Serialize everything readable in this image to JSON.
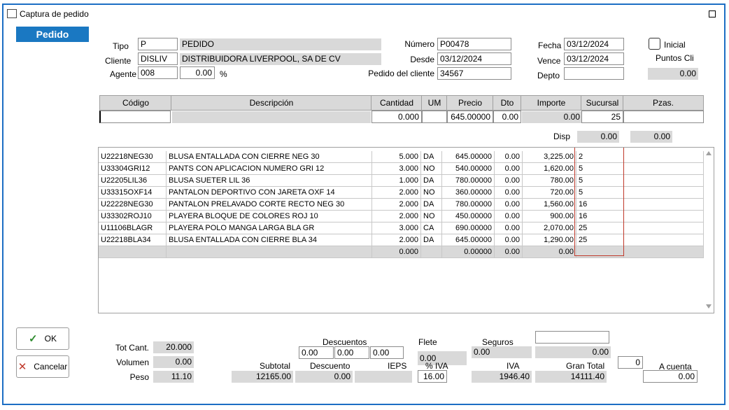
{
  "window": {
    "title": "Captura de pedido",
    "tab_label": "Pedido"
  },
  "header": {
    "tipo_label": "Tipo",
    "tipo_code": "P",
    "tipo_name": "PEDIDO",
    "cliente_label": "Cliente",
    "cliente_code": "DISLIV",
    "cliente_name": "DISTRIBUIDORA LIVERPOOL, SA DE CV",
    "agente_label": "Agente",
    "agente_code": "008",
    "agente_pct": "0.00",
    "pct_symbol": "%",
    "numero_label": "Número",
    "numero_value": "P00478",
    "desde_label": "Desde",
    "desde_value": "03/12/2024",
    "pedido_cliente_label": "Pedido del cliente",
    "pedido_cliente_value": "34567",
    "fecha_label": "Fecha",
    "fecha_value": "03/12/2024",
    "vence_label": "Vence",
    "vence_value": "03/12/2024",
    "depto_label": "Depto",
    "depto_value": "",
    "inicial_label": "Inicial",
    "puntos_label": "Puntos Cli",
    "puntos_value": "0.00"
  },
  "entry": {
    "headers": [
      "Código",
      "Descripción",
      "Cantidad",
      "UM",
      "Precio",
      "Dto",
      "Importe",
      "Sucursal",
      "Pzas."
    ],
    "codigo": "",
    "descripcion": "",
    "cantidad": "0.000",
    "um": "",
    "precio": "645.00000",
    "dto": "0.00",
    "importe": "0.00",
    "sucursal": "25",
    "pzas": "",
    "disp_label": "Disp",
    "disp_value": "0.00",
    "disp_value2": "0.00"
  },
  "lines": [
    {
      "codigo": "U22218NEG30",
      "descripcion": "BLUSA ENTALLADA CON CIERRE NEG 30",
      "cantidad": "5.000",
      "um": "DA",
      "precio": "645.00000",
      "dto": "0.00",
      "importe": "3,225.00",
      "sucursal": "2"
    },
    {
      "codigo": "U33304GRI12",
      "descripcion": "PANTS CON APLICACION NUMERO GRI 12",
      "cantidad": "3.000",
      "um": "NO",
      "precio": "540.00000",
      "dto": "0.00",
      "importe": "1,620.00",
      "sucursal": "5"
    },
    {
      "codigo": "U22205LIL36",
      "descripcion": "BLUSA SUETER LIL 36",
      "cantidad": "1.000",
      "um": "DA",
      "precio": "780.00000",
      "dto": "0.00",
      "importe": "780.00",
      "sucursal": "5"
    },
    {
      "codigo": "U33315OXF14",
      "descripcion": "PANTALON  DEPORTIVO CON JARETA OXF 14",
      "cantidad": "2.000",
      "um": "NO",
      "precio": "360.00000",
      "dto": "0.00",
      "importe": "720.00",
      "sucursal": "5"
    },
    {
      "codigo": "U22228NEG30",
      "descripcion": "PANTALON PRELAVADO CORTE RECTO NEG 30",
      "cantidad": "2.000",
      "um": "DA",
      "precio": "780.00000",
      "dto": "0.00",
      "importe": "1,560.00",
      "sucursal": "16"
    },
    {
      "codigo": "U33302ROJ10",
      "descripcion": "PLAYERA BLOQUE DE COLORES ROJ 10",
      "cantidad": "2.000",
      "um": "NO",
      "precio": "450.00000",
      "dto": "0.00",
      "importe": "900.00",
      "sucursal": "16"
    },
    {
      "codigo": "U11106BLAGR",
      "descripcion": "PLAYERA POLO MANGA LARGA BLA GR",
      "cantidad": "3.000",
      "um": "CA",
      "precio": "690.00000",
      "dto": "0.00",
      "importe": "2,070.00",
      "sucursal": "25"
    },
    {
      "codigo": "U22218BLA34",
      "descripcion": "BLUSA ENTALLADA CON CIERRE BLA 34",
      "cantidad": "2.000",
      "um": "DA",
      "precio": "645.00000",
      "dto": "0.00",
      "importe": "1,290.00",
      "sucursal": "25"
    },
    {
      "codigo": "",
      "descripcion": "",
      "cantidad": "0.000",
      "um": "",
      "precio": "0.00000",
      "dto": "0.00",
      "importe": "0.00",
      "sucursal": ""
    }
  ],
  "buttons": {
    "ok": "OK",
    "cancel": "Cancelar"
  },
  "totals": {
    "tot_cant_label": "Tot Cant.",
    "tot_cant": "20.000",
    "volumen_label": "Volumen",
    "volumen": "0.00",
    "peso_label": "Peso",
    "peso": "11.10",
    "descuentos_label": "Descuentos",
    "desc1": "0.00",
    "desc2": "0.00",
    "desc3": "0.00",
    "flete_label": "Flete",
    "flete": "0.00",
    "seguros_label": "Seguros",
    "seguros": "0.00",
    "extra_box": "",
    "extra_value": "0.00",
    "subtotal_label": "Subtotal",
    "subtotal": "12165.00",
    "descuento_label": "Descuento",
    "descuento": "0.00",
    "ieps_label": "IEPS",
    "ieps": "",
    "pct_iva_label": "% IVA",
    "pct_iva": "16.00",
    "iva_label": "IVA",
    "iva": "1946.40",
    "gran_total_label": "Gran Total",
    "gran_total": "14111.40",
    "a_cuenta_small": "0",
    "a_cuenta_label": "A cuenta",
    "a_cuenta": "0.00"
  },
  "colors": {
    "accent": "#1c6ec4",
    "tab_bg": "#1a78c2",
    "field_gray": "#d9d9d9",
    "highlight_border": "#c0392b"
  }
}
